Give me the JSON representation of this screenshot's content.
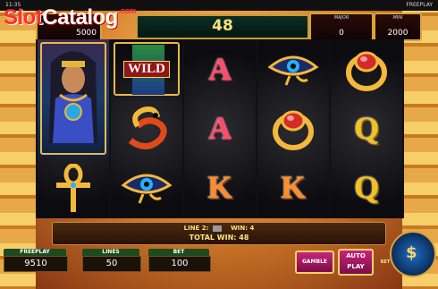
{
  "status": {
    "time": "11:35",
    "mode": "FREEPLAY"
  },
  "logo": {
    "part1": "Slot",
    "part2": "Catalog",
    "part3": ".com"
  },
  "header": {
    "coins": "5000",
    "win": "48",
    "major_label": "MAJOR",
    "major_value": "0",
    "mini_label": "MINI",
    "mini_value": "2000"
  },
  "reels": [
    [
      "cleopatra-wild",
      "cleopatra-wild",
      "ankh"
    ],
    [
      "wild",
      "snake",
      "eye-of-horus"
    ],
    [
      "A",
      "A",
      "K"
    ],
    [
      "eye-of-horus",
      "ring",
      "K"
    ],
    [
      "ring",
      "Q",
      "Q"
    ]
  ],
  "wild_label": "WILD",
  "info": {
    "line_label": "LINE 2:",
    "win_label": "WIN: 4",
    "total": "TOTAL WIN: 48"
  },
  "bottom": {
    "freeplay_label": "FREEPLAY",
    "freeplay_value": "9510",
    "lines_label": "LINES",
    "lines_value": "50",
    "bet_label": "BET",
    "bet_value": "100"
  },
  "buttons": {
    "gamble": "GAMBLE",
    "auto": "AUTO",
    "play": "PLAY",
    "bet": "BET"
  },
  "colors": {
    "accent": "#d9a33a",
    "button": "#c9237d",
    "spin": "#1f6fc4"
  }
}
